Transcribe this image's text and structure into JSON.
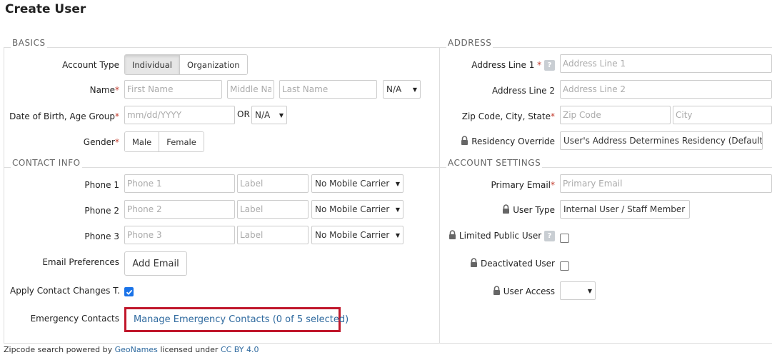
{
  "page": {
    "title": "Create User"
  },
  "basics": {
    "section_title": "BASICS",
    "account_type": {
      "label": "Account Type",
      "options": [
        "Individual",
        "Organization"
      ],
      "selected": "Individual"
    },
    "name": {
      "label": "Name",
      "required_mark": "*",
      "first_placeholder": "First Name",
      "middle_placeholder": "Middle Na",
      "last_placeholder": "Last Name",
      "suffix_value": "N/A"
    },
    "dob": {
      "label": "Date of Birth, Age Group",
      "required_mark": "*",
      "placeholder": "mm/dd/YYYY",
      "or_text": "OR",
      "age_group_value": "N/A"
    },
    "gender": {
      "label": "Gender",
      "required_mark": "*",
      "options": [
        "Male",
        "Female"
      ]
    }
  },
  "contact": {
    "section_title": "CONTACT INFO",
    "phones": [
      {
        "label": "Phone 1",
        "placeholder": "Phone 1",
        "label_placeholder": "Label",
        "carrier": "No Mobile Carrier"
      },
      {
        "label": "Phone 2",
        "placeholder": "Phone 2",
        "label_placeholder": "Label",
        "carrier": "No Mobile Carrier"
      },
      {
        "label": "Phone 3",
        "placeholder": "Phone 3",
        "label_placeholder": "Label",
        "carrier": "No Mobile Carrier"
      }
    ],
    "email_prefs": {
      "label": "Email Preferences",
      "button": "Add Email"
    },
    "apply_changes": {
      "label": "Apply Contact Changes T...",
      "checked": true
    },
    "emergency": {
      "label": "Emergency Contacts",
      "link": "Manage Emergency Contacts (0 of 5 selected)"
    }
  },
  "address": {
    "section_title": "ADDRESS",
    "line1": {
      "label": "Address Line 1",
      "required_mark": "*",
      "help": "?",
      "placeholder": "Address Line 1"
    },
    "line2": {
      "label": "Address Line 2",
      "placeholder": "Address Line 2"
    },
    "zip": {
      "label": "Zip Code, City, State",
      "required_mark": "*",
      "zip_placeholder": "Zip Code",
      "city_placeholder": "City"
    },
    "residency": {
      "label": "Residency Override",
      "value": "User's Address Determines Residency (Default)"
    }
  },
  "account": {
    "section_title": "ACCOUNT SETTINGS",
    "email": {
      "label": "Primary Email",
      "required_mark": "*",
      "placeholder": "Primary Email"
    },
    "user_type": {
      "label": "User Type",
      "value": "Internal User / Staff Member"
    },
    "limited_public": {
      "label": "Limited Public User",
      "help": "?",
      "checked": false
    },
    "deactivated": {
      "label": "Deactivated User",
      "checked": false
    },
    "user_access": {
      "label": "User Access",
      "value": ""
    }
  },
  "footer": {
    "prefix": "Zipcode search powered by ",
    "geonames": "GeoNames",
    "middle": " licensed under ",
    "license": "CC BY 4.0"
  },
  "colors": {
    "link": "#2f6a9f",
    "required": "#c0392b",
    "highlight": "#c0172b",
    "checkbox": "#1a73e8"
  }
}
